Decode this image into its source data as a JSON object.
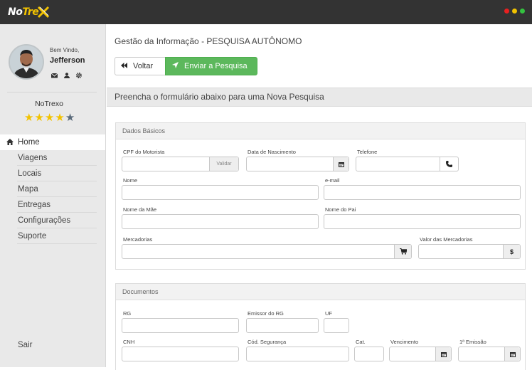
{
  "app": {
    "logo_prefix": "No",
    "logo_suffix": "Tre",
    "window_dots": [
      "#e82020",
      "#f2c200",
      "#34c240"
    ]
  },
  "sidebar": {
    "welcome": "Bem Vindo,",
    "username": "Jefferson",
    "user_icons": [
      "mail-icon",
      "user-icon",
      "settings-icon"
    ],
    "company": "NoTrexo",
    "rating": 4,
    "rating_max": 5,
    "items": [
      {
        "label": "Home",
        "icon": "home-icon",
        "active": true
      },
      {
        "label": "Viagens"
      },
      {
        "label": "Locais"
      },
      {
        "label": "Mapa"
      },
      {
        "label": "Entregas"
      },
      {
        "label": "Configurações"
      },
      {
        "label": "Suporte"
      }
    ],
    "logout": "Sair"
  },
  "main": {
    "title": "Gestão da Informação - PESQUISA AUTÔNOMO",
    "back_label": "Voltar",
    "send_label": "Enviar a Pesquisa",
    "form_header": "Preencha o formulário abaixo para uma Nova Pesquisa",
    "basic": {
      "title": "Dados Básicos",
      "cpf_label": "CPF do Motorista",
      "cpf_addon": "Validar",
      "birth_label": "Data de Nascimento",
      "phone_label": "Telefone",
      "name_label": "Nome",
      "email_label": "e-mail",
      "mother_label": "Nome da Mãe",
      "father_label": "Nome do Pai",
      "goods_label": "Mercadorias",
      "goods_value_label": "Valor das Mercadorias",
      "currency_addon": "$"
    },
    "docs": {
      "title": "Documentos",
      "rg_label": "RG",
      "rg_issuer_label": "Emissor do RG",
      "uf_label": "UF",
      "cnh_label": "CNH",
      "security_label": "Cód. Segurança",
      "cat_label": "Cat.",
      "due_label": "Vencimento",
      "first_issue_label": "1ª Emissão"
    }
  }
}
